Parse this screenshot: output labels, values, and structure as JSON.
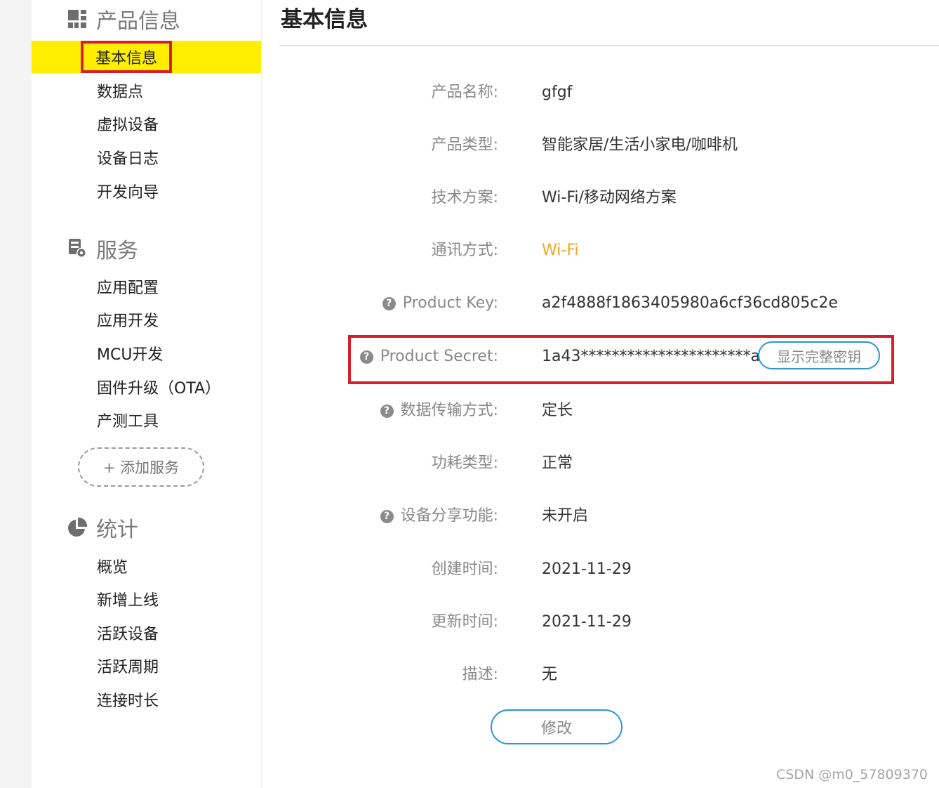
{
  "sidebar": {
    "product_section": {
      "title": "产品信息",
      "icon": "grid-icon"
    },
    "product_items": [
      {
        "label": "基本信息",
        "active": true
      },
      {
        "label": "数据点"
      },
      {
        "label": "虚拟设备"
      },
      {
        "label": "设备日志"
      },
      {
        "label": "开发向导"
      }
    ],
    "service_section": {
      "title": "服务",
      "icon": "service-gear-icon"
    },
    "service_items": [
      {
        "label": "应用配置"
      },
      {
        "label": "应用开发"
      },
      {
        "label": "MCU开发"
      },
      {
        "label": "固件升级（OTA）"
      },
      {
        "label": "产测工具"
      }
    ],
    "add_service_label": "+ 添加服务",
    "stats_section": {
      "title": "统计",
      "icon": "pie-chart-icon"
    },
    "stats_items": [
      {
        "label": "概览"
      },
      {
        "label": "新增上线"
      },
      {
        "label": "活跃设备"
      },
      {
        "label": "活跃周期"
      },
      {
        "label": "连接时长"
      }
    ]
  },
  "main": {
    "title": "基本信息",
    "fields": [
      {
        "label": "产品名称:",
        "value": "gfgf"
      },
      {
        "label": "产品类型:",
        "value": "智能家居/生活小家电/咖啡机"
      },
      {
        "label": "技术方案:",
        "value": "Wi-Fi/移动网络方案"
      },
      {
        "label": "通讯方式:",
        "value": "Wi-Fi",
        "accent": "#f5a623"
      },
      {
        "label": "Product Key:",
        "value": "a2f4888f1863405980a6cf36cd805c2e",
        "help": true
      },
      {
        "label": "Product Secret:",
        "value": "1a43**********************a3e8",
        "help": true
      },
      {
        "label": "数据传输方式:",
        "value": "定长",
        "help": true
      },
      {
        "label": "功耗类型:",
        "value": "正常"
      },
      {
        "label": "设备分享功能:",
        "value": "未开启",
        "help": true
      },
      {
        "label": "创建时间:",
        "value": "2021-11-29"
      },
      {
        "label": "更新时间:",
        "value": "2021-11-29"
      },
      {
        "label": "描述:",
        "value": "无"
      }
    ],
    "show_key_button": "显示完整密钥",
    "edit_button": "修改",
    "help_glyph": "?"
  },
  "watermark": "CSDN @m0_57809370",
  "colors": {
    "active_bg": "#ffee00",
    "highlight": "#d81e2a",
    "button_border": "#2b95d6",
    "accent": "#f5a623"
  }
}
